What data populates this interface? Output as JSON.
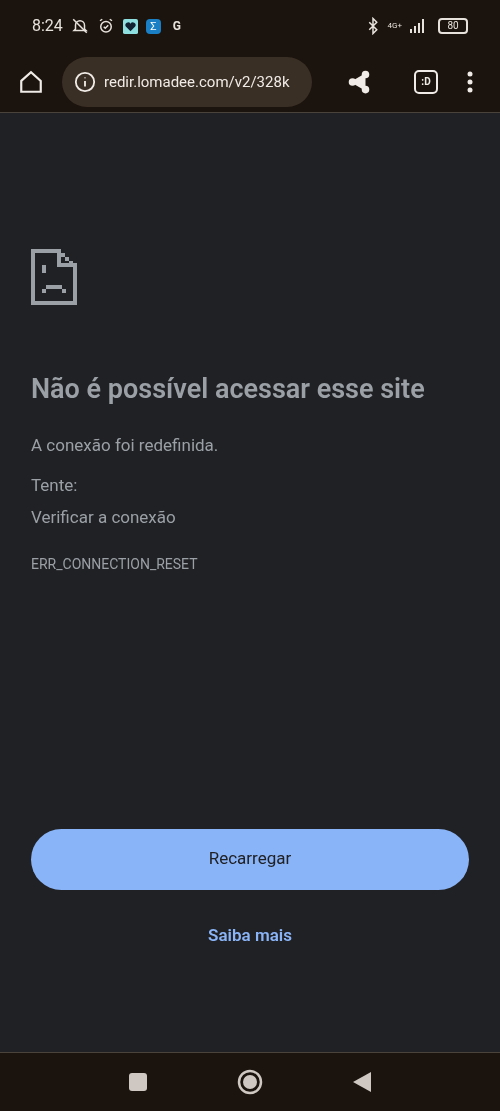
{
  "status_bar": {
    "time": "8:24",
    "app_icons": [
      "Σ",
      "G"
    ],
    "network": "4G+",
    "battery": "80"
  },
  "toolbar": {
    "url": "redir.lomadee.com/v2/328k",
    "tab_switcher": ":D"
  },
  "error_page": {
    "title": "Não é possível acessar esse site",
    "message": "A conexão foi redefinida.",
    "try_label": "Tente:",
    "suggestions": [
      "Verificar a conexão"
    ],
    "error_code": "ERR_CONNECTION_RESET",
    "reload_button": "Recarregar",
    "learn_more_link": "Saiba mais"
  }
}
